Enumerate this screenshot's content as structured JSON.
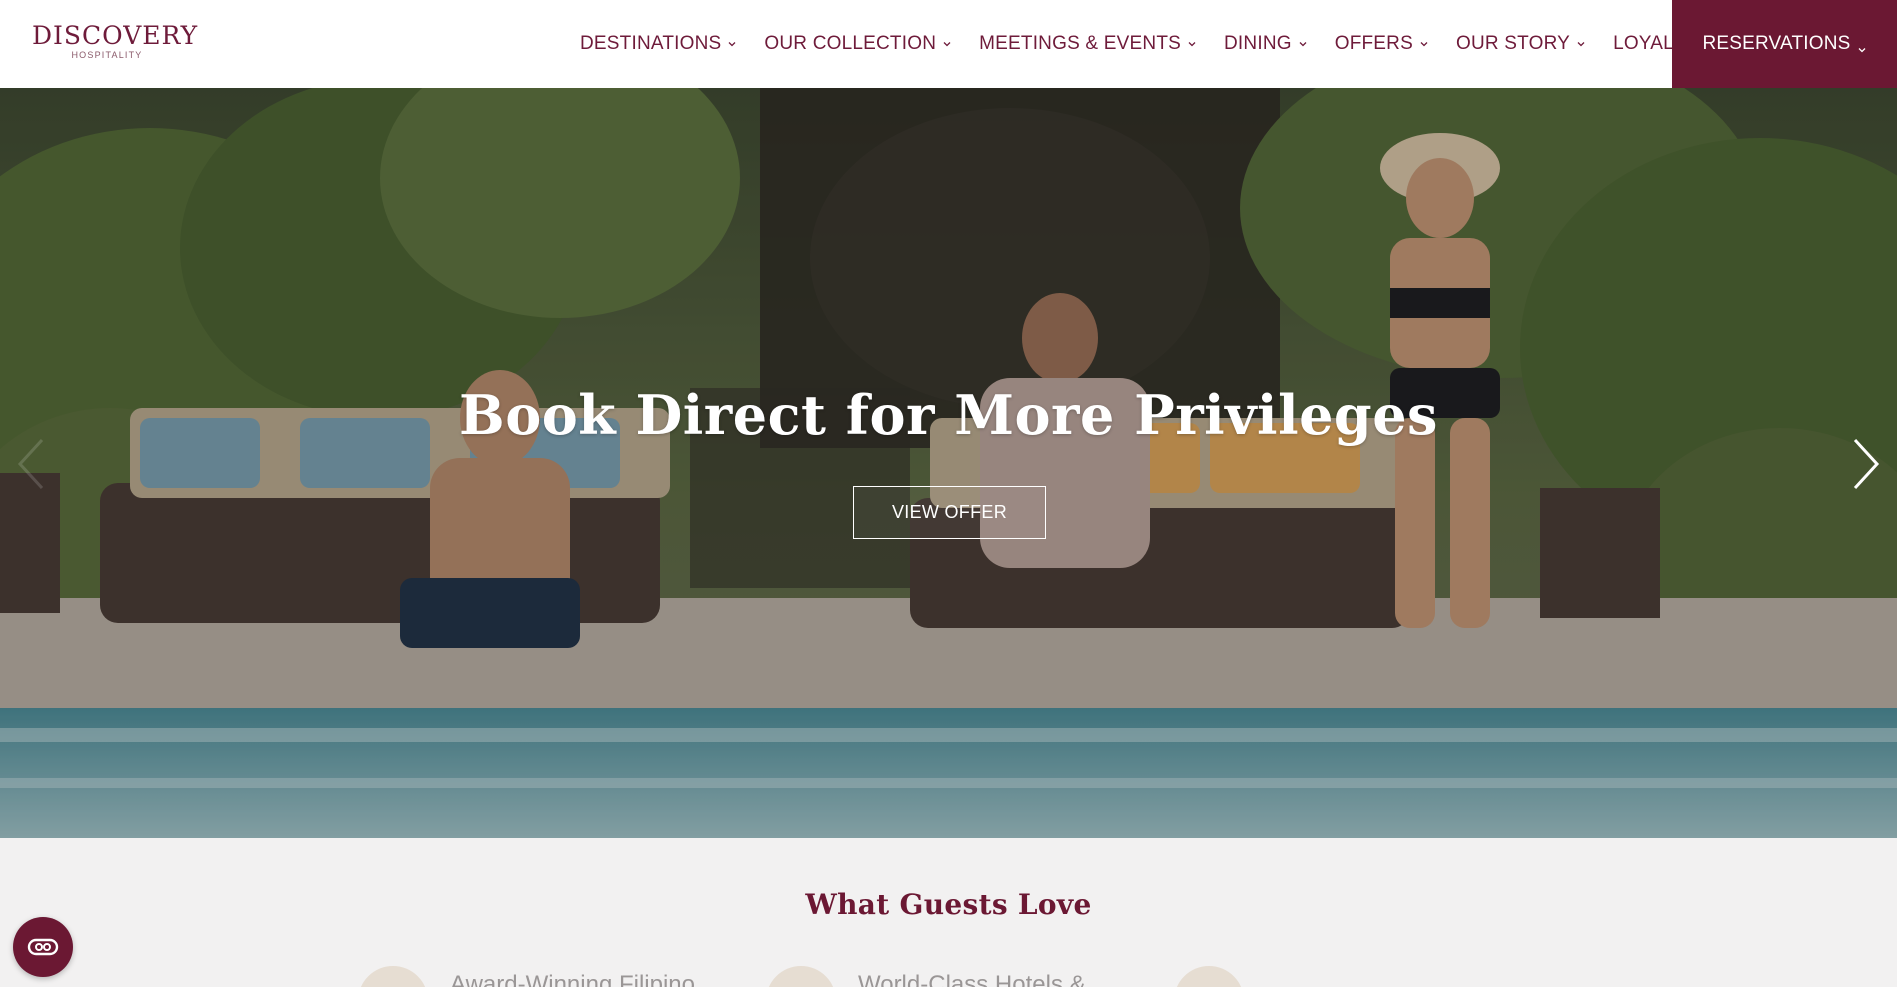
{
  "brand": {
    "name": "DISCOVERY",
    "tagline": "HOSPITALITY",
    "color": "#6b1833"
  },
  "nav": {
    "items": [
      {
        "label": "DESTINATIONS"
      },
      {
        "label": "OUR COLLECTION"
      },
      {
        "label": "MEETINGS & EVENTS"
      },
      {
        "label": "DINING"
      },
      {
        "label": "OFFERS"
      },
      {
        "label": "OUR STORY"
      },
      {
        "label": "LOYALTY"
      }
    ],
    "reservations_label": "RESERVATIONS"
  },
  "hero": {
    "title": "Book Direct for More Privileges",
    "cta_label": "VIEW OFFER",
    "next_icon": "chevron-right-icon",
    "prev_icon": "chevron-left-icon"
  },
  "section": {
    "title": "What Guests Love",
    "features": [
      {
        "label": "Award-Winning Filipino",
        "icon": "heart-icon"
      },
      {
        "label": "World-Class Hotels &",
        "icon": "close-icon"
      },
      {
        "label": "",
        "icon": "award-icon"
      }
    ]
  },
  "chat": {
    "icon": "chat-icon"
  }
}
